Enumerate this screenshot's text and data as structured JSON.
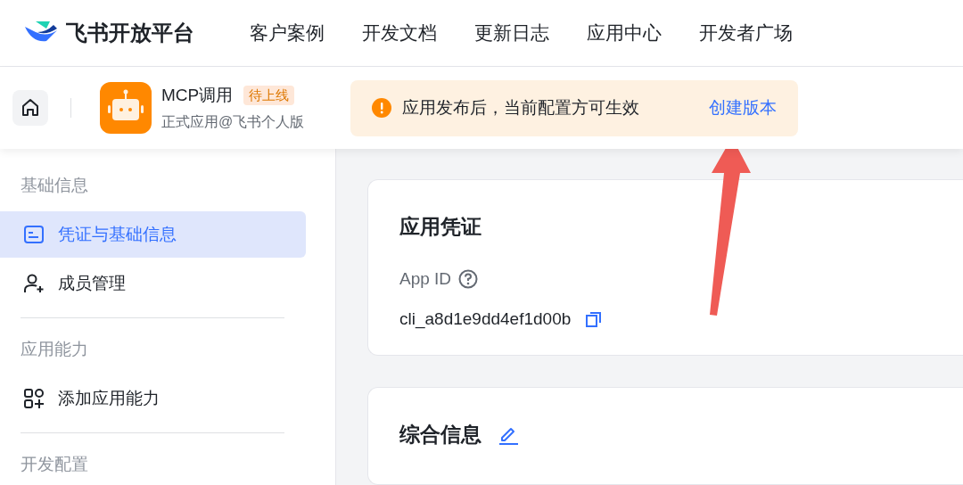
{
  "brand": {
    "name": "飞书开放平台"
  },
  "nav": [
    {
      "label": "客户案例"
    },
    {
      "label": "开发文档"
    },
    {
      "label": "更新日志"
    },
    {
      "label": "应用中心"
    },
    {
      "label": "开发者广场"
    }
  ],
  "app": {
    "name": "MCP调用",
    "badge": "待上线",
    "subtitle": "正式应用@飞书个人版"
  },
  "notice": {
    "text": "应用发布后，当前配置方可生效",
    "action": "创建版本"
  },
  "sidebar": [
    {
      "title": "基础信息",
      "items": [
        {
          "label": "凭证与基础信息",
          "kind": "card",
          "selected": true
        },
        {
          "label": "成员管理",
          "kind": "person",
          "selected": false
        }
      ]
    },
    {
      "title": "应用能力",
      "items": [
        {
          "label": "添加应用能力",
          "kind": "grid",
          "selected": false
        }
      ]
    },
    {
      "title": "开发配置"
    }
  ],
  "cards": [
    {
      "title": "应用凭证",
      "editable": false,
      "field_label": "App ID",
      "field_value": "cli_a8d1e9dd4ef1d00b"
    },
    {
      "title": "综合信息",
      "editable": true
    }
  ]
}
